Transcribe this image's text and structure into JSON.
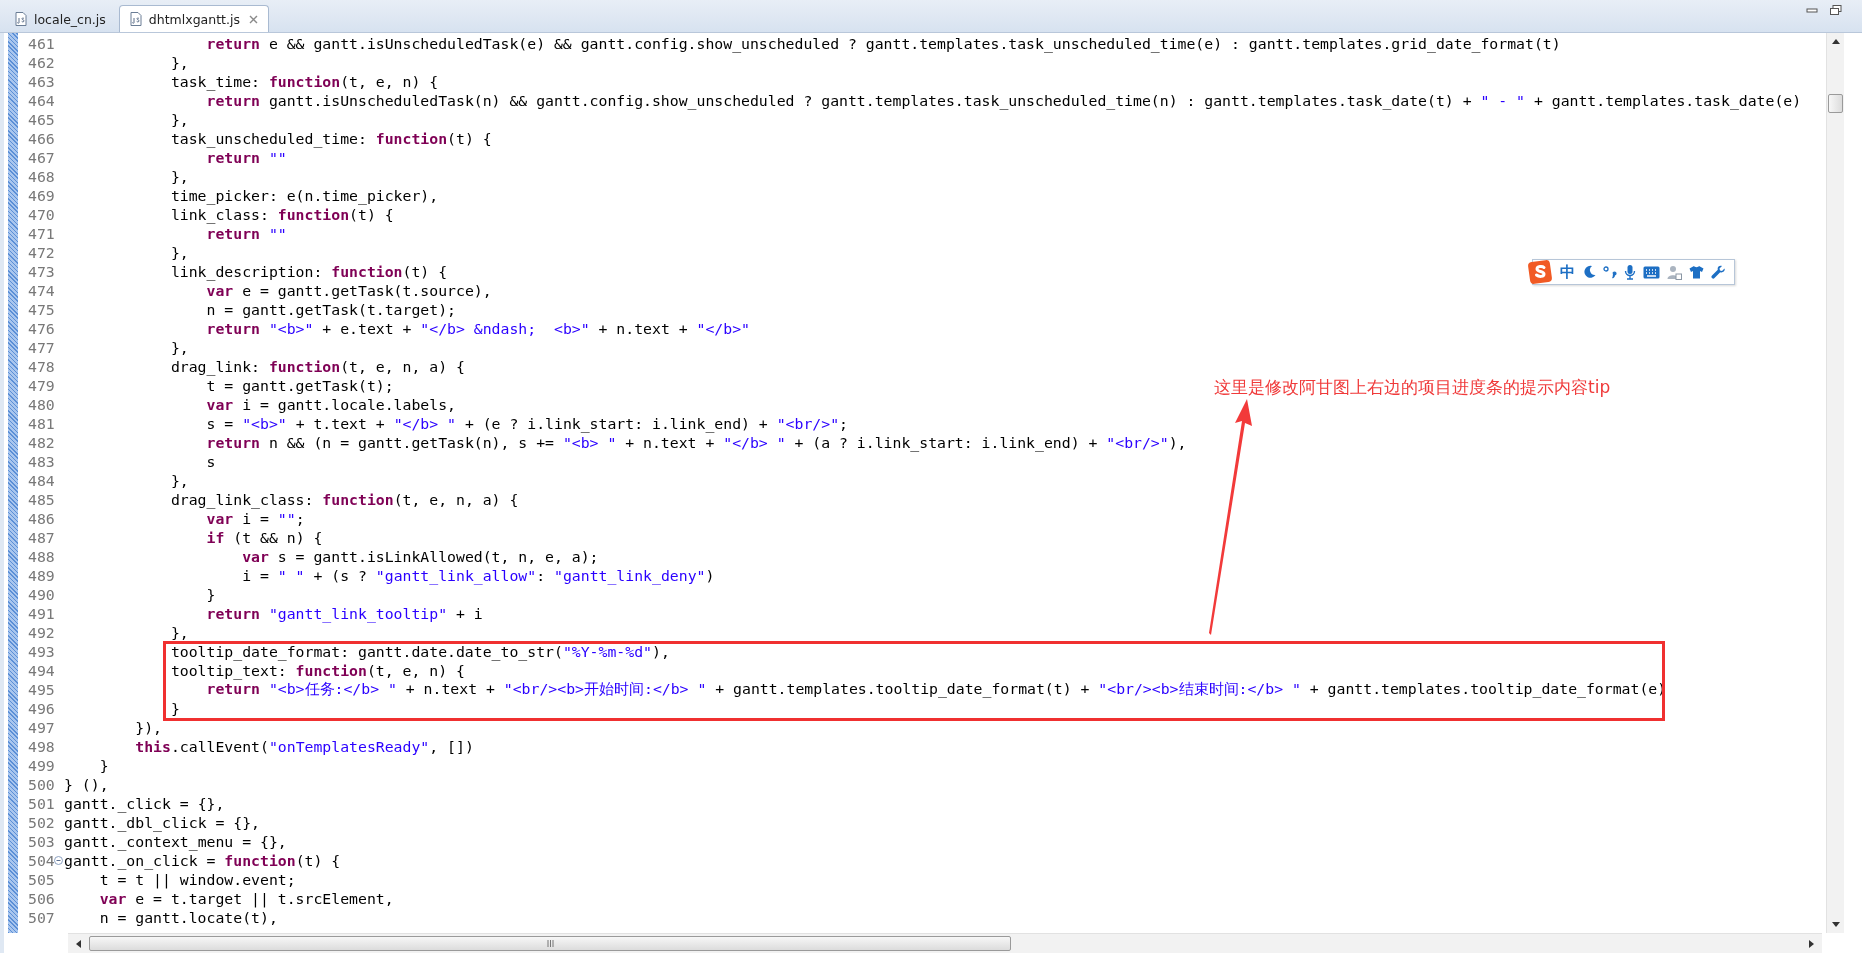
{
  "tabs": [
    {
      "label": "locale_cn.js",
      "selected": false,
      "closable": false
    },
    {
      "label": "dhtmlxgantt.js",
      "selected": true,
      "closable": true
    }
  ],
  "editor": {
    "lines": [
      {
        "number": "461",
        "foldable": false,
        "tokens": [
          {
            "kind": "keyword",
            "text": "                return"
          },
          {
            "kind": "plain",
            "text": " e && gantt.isUnscheduledTask(e) && gantt.config.show_unscheduled ? gantt.templates.task_unscheduled_time(e) : gantt.templates.grid_date_format(t)"
          }
        ]
      },
      {
        "number": "462",
        "foldable": false,
        "tokens": [
          {
            "kind": "plain",
            "text": "            },"
          }
        ]
      },
      {
        "number": "463",
        "foldable": false,
        "tokens": [
          {
            "kind": "plain",
            "text": "            task_time: "
          },
          {
            "kind": "keyword",
            "text": "function"
          },
          {
            "kind": "plain",
            "text": "(t, e, n) {"
          }
        ]
      },
      {
        "number": "464",
        "foldable": false,
        "tokens": [
          {
            "kind": "keyword",
            "text": "                return"
          },
          {
            "kind": "plain",
            "text": " gantt.isUnscheduledTask(n) && gantt.config.show_unscheduled ? gantt.templates.task_unscheduled_time(n) : gantt.templates.task_date(t) + "
          },
          {
            "kind": "string",
            "text": "\" - \""
          },
          {
            "kind": "plain",
            "text": " + gantt.templates.task_date(e)"
          }
        ]
      },
      {
        "number": "465",
        "foldable": false,
        "tokens": [
          {
            "kind": "plain",
            "text": "            },"
          }
        ]
      },
      {
        "number": "466",
        "foldable": false,
        "tokens": [
          {
            "kind": "plain",
            "text": "            task_unscheduled_time: "
          },
          {
            "kind": "keyword",
            "text": "function"
          },
          {
            "kind": "plain",
            "text": "(t) {"
          }
        ]
      },
      {
        "number": "467",
        "foldable": false,
        "tokens": [
          {
            "kind": "keyword",
            "text": "                return"
          },
          {
            "kind": "string",
            "text": " \"\""
          }
        ]
      },
      {
        "number": "468",
        "foldable": false,
        "tokens": [
          {
            "kind": "plain",
            "text": "            },"
          }
        ]
      },
      {
        "number": "469",
        "foldable": false,
        "tokens": [
          {
            "kind": "plain",
            "text": "            time_picker: e(n.time_picker),"
          }
        ]
      },
      {
        "number": "470",
        "foldable": false,
        "tokens": [
          {
            "kind": "plain",
            "text": "            link_class: "
          },
          {
            "kind": "keyword",
            "text": "function"
          },
          {
            "kind": "plain",
            "text": "(t) {"
          }
        ]
      },
      {
        "number": "471",
        "foldable": false,
        "tokens": [
          {
            "kind": "keyword",
            "text": "                return"
          },
          {
            "kind": "string",
            "text": " \"\""
          }
        ]
      },
      {
        "number": "472",
        "foldable": false,
        "tokens": [
          {
            "kind": "plain",
            "text": "            },"
          }
        ]
      },
      {
        "number": "473",
        "foldable": false,
        "tokens": [
          {
            "kind": "plain",
            "text": "            link_description: "
          },
          {
            "kind": "keyword",
            "text": "function"
          },
          {
            "kind": "plain",
            "text": "(t) {"
          }
        ]
      },
      {
        "number": "474",
        "foldable": false,
        "tokens": [
          {
            "kind": "keyword",
            "text": "                var"
          },
          {
            "kind": "plain",
            "text": " e = gantt.getTask(t.source),"
          }
        ]
      },
      {
        "number": "475",
        "foldable": false,
        "tokens": [
          {
            "kind": "plain",
            "text": "                n = gantt.getTask(t.target);"
          }
        ]
      },
      {
        "number": "476",
        "foldable": false,
        "tokens": [
          {
            "kind": "keyword",
            "text": "                return"
          },
          {
            "kind": "string",
            "text": " \"<b>\""
          },
          {
            "kind": "plain",
            "text": " + e.text + "
          },
          {
            "kind": "string",
            "text": "\"</b> &ndash;  <b>\""
          },
          {
            "kind": "plain",
            "text": " + n.text + "
          },
          {
            "kind": "string",
            "text": "\"</b>\""
          }
        ]
      },
      {
        "number": "477",
        "foldable": false,
        "tokens": [
          {
            "kind": "plain",
            "text": "            },"
          }
        ]
      },
      {
        "number": "478",
        "foldable": false,
        "tokens": [
          {
            "kind": "plain",
            "text": "            drag_link: "
          },
          {
            "kind": "keyword",
            "text": "function"
          },
          {
            "kind": "plain",
            "text": "(t, e, n, a) {"
          }
        ]
      },
      {
        "number": "479",
        "foldable": false,
        "tokens": [
          {
            "kind": "plain",
            "text": "                t = gantt.getTask(t);"
          }
        ]
      },
      {
        "number": "480",
        "foldable": false,
        "tokens": [
          {
            "kind": "keyword",
            "text": "                var"
          },
          {
            "kind": "plain",
            "text": " i = gantt.locale.labels,"
          }
        ]
      },
      {
        "number": "481",
        "foldable": false,
        "tokens": [
          {
            "kind": "plain",
            "text": "                s = "
          },
          {
            "kind": "string",
            "text": "\"<b>\""
          },
          {
            "kind": "plain",
            "text": " + t.text + "
          },
          {
            "kind": "string",
            "text": "\"</b> \""
          },
          {
            "kind": "plain",
            "text": " + (e ? i.link_start: i.link_end) + "
          },
          {
            "kind": "string",
            "text": "\"<br/>\""
          },
          {
            "kind": "plain",
            "text": ";"
          }
        ]
      },
      {
        "number": "482",
        "foldable": false,
        "tokens": [
          {
            "kind": "keyword",
            "text": "                return"
          },
          {
            "kind": "plain",
            "text": " n && (n = gantt.getTask(n), s += "
          },
          {
            "kind": "string",
            "text": "\"<b> \""
          },
          {
            "kind": "plain",
            "text": " + n.text + "
          },
          {
            "kind": "string",
            "text": "\"</b> \""
          },
          {
            "kind": "plain",
            "text": " + (a ? i.link_start: i.link_end) + "
          },
          {
            "kind": "string",
            "text": "\"<br/>\""
          },
          {
            "kind": "plain",
            "text": "),"
          }
        ]
      },
      {
        "number": "483",
        "foldable": false,
        "tokens": [
          {
            "kind": "plain",
            "text": "                s"
          }
        ]
      },
      {
        "number": "484",
        "foldable": false,
        "tokens": [
          {
            "kind": "plain",
            "text": "            },"
          }
        ]
      },
      {
        "number": "485",
        "foldable": false,
        "tokens": [
          {
            "kind": "plain",
            "text": "            drag_link_class: "
          },
          {
            "kind": "keyword",
            "text": "function"
          },
          {
            "kind": "plain",
            "text": "(t, e, n, a) {"
          }
        ]
      },
      {
        "number": "486",
        "foldable": false,
        "tokens": [
          {
            "kind": "keyword",
            "text": "                var"
          },
          {
            "kind": "plain",
            "text": " i = "
          },
          {
            "kind": "string",
            "text": "\"\""
          },
          {
            "kind": "plain",
            "text": ";"
          }
        ]
      },
      {
        "number": "487",
        "foldable": false,
        "tokens": [
          {
            "kind": "keyword",
            "text": "                if"
          },
          {
            "kind": "plain",
            "text": " (t && n) {"
          }
        ]
      },
      {
        "number": "488",
        "foldable": false,
        "tokens": [
          {
            "kind": "keyword",
            "text": "                    var"
          },
          {
            "kind": "plain",
            "text": " s = gantt.isLinkAllowed(t, n, e, a);"
          }
        ]
      },
      {
        "number": "489",
        "foldable": false,
        "tokens": [
          {
            "kind": "plain",
            "text": "                    i = "
          },
          {
            "kind": "string",
            "text": "\" \""
          },
          {
            "kind": "plain",
            "text": " + (s ? "
          },
          {
            "kind": "string",
            "text": "\"gantt_link_allow\""
          },
          {
            "kind": "plain",
            "text": ": "
          },
          {
            "kind": "string",
            "text": "\"gantt_link_deny\""
          },
          {
            "kind": "plain",
            "text": ")"
          }
        ]
      },
      {
        "number": "490",
        "foldable": false,
        "tokens": [
          {
            "kind": "plain",
            "text": "                }"
          }
        ]
      },
      {
        "number": "491",
        "foldable": false,
        "tokens": [
          {
            "kind": "keyword",
            "text": "                return"
          },
          {
            "kind": "string",
            "text": " \"gantt_link_tooltip\""
          },
          {
            "kind": "plain",
            "text": " + i"
          }
        ]
      },
      {
        "number": "492",
        "foldable": false,
        "tokens": [
          {
            "kind": "plain",
            "text": "            },"
          }
        ]
      }
    ],
    "highlighted_lines": [
      {
        "number": "493",
        "foldable": false,
        "tokens": [
          {
            "kind": "plain",
            "text": "            tooltip_date_format: gantt.date.date_to_str("
          },
          {
            "kind": "string",
            "text": "\"%Y-%m-%d\""
          },
          {
            "kind": "plain",
            "text": "),"
          }
        ]
      },
      {
        "number": "494",
        "foldable": false,
        "tokens": [
          {
            "kind": "plain",
            "text": "            tooltip_text: "
          },
          {
            "kind": "keyword",
            "text": "function"
          },
          {
            "kind": "plain",
            "text": "(t, e, n) {"
          }
        ]
      },
      {
        "number": "495",
        "foldable": false,
        "tokens": [
          {
            "kind": "keyword",
            "text": "                return"
          },
          {
            "kind": "string",
            "text": " \"<b>任务:</b> \""
          },
          {
            "kind": "plain",
            "text": " + n.text + "
          },
          {
            "kind": "string",
            "text": "\"<br/><b>开始时间:</b> \""
          },
          {
            "kind": "plain",
            "text": " + gantt.templates.tooltip_date_format(t) + "
          },
          {
            "kind": "string",
            "text": "\"<br/><b>结束时间:</b> \""
          },
          {
            "kind": "plain",
            "text": " + gantt.templates.tooltip_date_format(e)"
          }
        ]
      },
      {
        "number": "496",
        "foldable": false,
        "tokens": [
          {
            "kind": "plain",
            "text": "            }"
          }
        ]
      }
    ],
    "lines_after": [
      {
        "number": "497",
        "foldable": false,
        "tokens": [
          {
            "kind": "plain",
            "text": "        }),"
          }
        ]
      },
      {
        "number": "498",
        "foldable": false,
        "tokens": [
          {
            "kind": "keyword",
            "text": "        this"
          },
          {
            "kind": "plain",
            "text": ".callEvent("
          },
          {
            "kind": "string",
            "text": "\"onTemplatesReady\""
          },
          {
            "kind": "plain",
            "text": ", [])"
          }
        ]
      },
      {
        "number": "499",
        "foldable": false,
        "tokens": [
          {
            "kind": "plain",
            "text": "    }"
          }
        ]
      },
      {
        "number": "500",
        "foldable": false,
        "tokens": [
          {
            "kind": "plain",
            "text": "} (),"
          }
        ]
      },
      {
        "number": "501",
        "foldable": false,
        "tokens": [
          {
            "kind": "plain",
            "text": "gantt._click = {},"
          }
        ]
      },
      {
        "number": "502",
        "foldable": false,
        "tokens": [
          {
            "kind": "plain",
            "text": "gantt._dbl_click = {},"
          }
        ]
      },
      {
        "number": "503",
        "foldable": false,
        "tokens": [
          {
            "kind": "plain",
            "text": "gantt._context_menu = {},"
          }
        ]
      },
      {
        "number": "504",
        "foldable": true,
        "tokens": [
          {
            "kind": "plain",
            "text": "gantt._on_click = "
          },
          {
            "kind": "keyword",
            "text": "function"
          },
          {
            "kind": "plain",
            "text": "(t) {"
          }
        ]
      },
      {
        "number": "505",
        "foldable": false,
        "tokens": [
          {
            "kind": "plain",
            "text": "    t = t || window.event;"
          }
        ]
      },
      {
        "number": "506",
        "foldable": false,
        "tokens": [
          {
            "kind": "keyword",
            "text": "    var"
          },
          {
            "kind": "plain",
            "text": " e = t.target || t.srcElement,"
          }
        ]
      },
      {
        "number": "507",
        "foldable": false,
        "tokens": [
          {
            "kind": "plain",
            "text": "    n = gantt.locate(t),"
          }
        ]
      }
    ]
  },
  "annotation": {
    "text": "这里是修改阿甘图上右边的项目进度条的提示内容tip"
  },
  "ime_toolbar": {
    "mode_label": "中"
  }
}
